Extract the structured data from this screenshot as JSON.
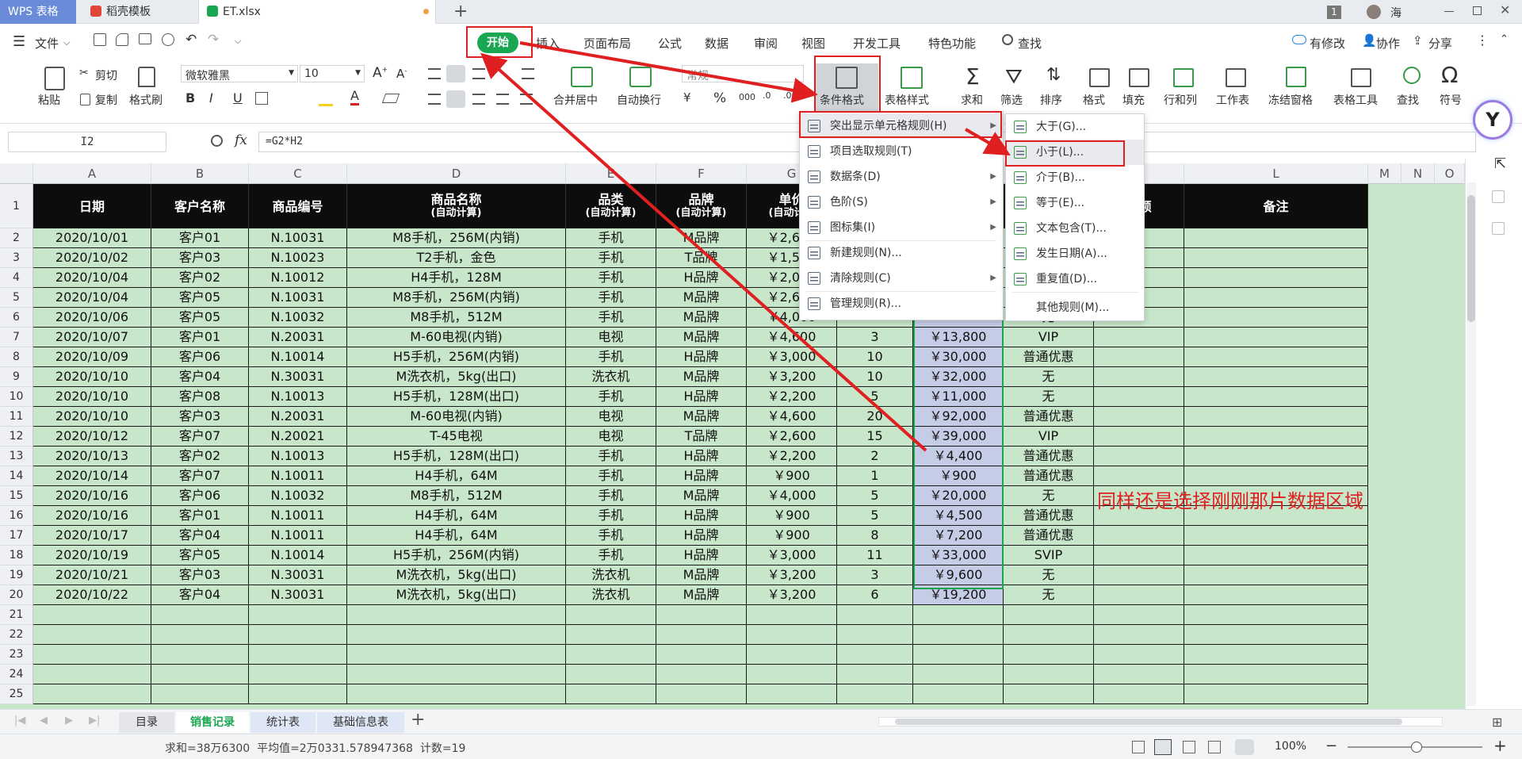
{
  "tabs": {
    "app": "WPS 表格",
    "templates": "稻壳模板",
    "file": "ET.xlsx",
    "add": "+",
    "badge": "1",
    "user": "海"
  },
  "menu": {
    "file": "文件",
    "items": [
      "开始",
      "插入",
      "页面布局",
      "公式",
      "数据",
      "审阅",
      "视图",
      "开发工具",
      "特色功能"
    ],
    "search": "查找",
    "modified": "有修改",
    "collab": "协作",
    "share": "分享"
  },
  "ribbon": {
    "paste": "粘贴",
    "cut": "剪切",
    "copy": "复制",
    "format_painter": "格式刷",
    "font_name": "微软雅黑",
    "font_size": "10",
    "bold": "B",
    "italic": "I",
    "underline": "U",
    "merge": "合并居中",
    "wrap": "自动换行",
    "number_format": "常规",
    "cond_format": "条件格式",
    "table_style": "表格样式",
    "sum": "求和",
    "filter": "筛选",
    "sort": "排序",
    "format": "格式",
    "fill": "填充",
    "rowcol": "行和列",
    "worksheet": "工作表",
    "freeze": "冻结窗格",
    "table_tools": "表格工具",
    "find": "查找",
    "symbol": "符号"
  },
  "formula": {
    "cell_ref": "I2",
    "fx": "fx",
    "formula": "=G2*H2"
  },
  "columns": [
    "A",
    "B",
    "C",
    "D",
    "E",
    "F",
    "G",
    "H",
    "I",
    "J",
    "K",
    "L",
    "M",
    "N",
    "O"
  ],
  "headers": [
    {
      "main": "日期",
      "sub": ""
    },
    {
      "main": "客户名称",
      "sub": ""
    },
    {
      "main": "商品编号",
      "sub": ""
    },
    {
      "main": "商品名称",
      "sub": "(自动计算)"
    },
    {
      "main": "品类",
      "sub": "(自动计算)"
    },
    {
      "main": "品牌",
      "sub": "(自动计算)"
    },
    {
      "main": "单价",
      "sub": "(自动计算"
    },
    {
      "main": "",
      "sub": ""
    },
    {
      "main": "",
      "sub": ""
    },
    {
      "main": "",
      "sub": ""
    },
    {
      "main": "金额",
      "sub": ""
    },
    {
      "main": "备注",
      "sub": ""
    }
  ],
  "rows": [
    [
      "2020/10/01",
      "客户01",
      "N.10031",
      "M8手机，256M(内销)",
      "手机",
      "M品牌",
      "￥2,600",
      "",
      "",
      "",
      ""
    ],
    [
      "2020/10/02",
      "客户03",
      "N.10023",
      "T2手机，金色",
      "手机",
      "T品牌",
      "￥1,500",
      "",
      "",
      "",
      ""
    ],
    [
      "2020/10/04",
      "客户02",
      "N.10012",
      "H4手机，128M",
      "手机",
      "H品牌",
      "￥2,000",
      "",
      "",
      "",
      ""
    ],
    [
      "2020/10/04",
      "客户05",
      "N.10031",
      "M8手机，256M(内销)",
      "手机",
      "M品牌",
      "￥2,600",
      "",
      "",
      "",
      ""
    ],
    [
      "2020/10/06",
      "客户05",
      "N.10032",
      "M8手机，512M",
      "手机",
      "M品牌",
      "￥4,000",
      "",
      "",
      "无",
      ""
    ],
    [
      "2020/10/07",
      "客户01",
      "N.20031",
      "M-60电视(内销)",
      "电视",
      "M品牌",
      "￥4,600",
      "3",
      "￥13,800",
      "VIP",
      ""
    ],
    [
      "2020/10/09",
      "客户06",
      "N.10014",
      "H5手机，256M(内销)",
      "手机",
      "H品牌",
      "￥3,000",
      "10",
      "￥30,000",
      "普通优惠",
      ""
    ],
    [
      "2020/10/10",
      "客户04",
      "N.30031",
      "M洗衣机，5kg(出口)",
      "洗衣机",
      "M品牌",
      "￥3,200",
      "10",
      "￥32,000",
      "无",
      ""
    ],
    [
      "2020/10/10",
      "客户08",
      "N.10013",
      "H5手机，128M(出口)",
      "手机",
      "H品牌",
      "￥2,200",
      "5",
      "￥11,000",
      "无",
      ""
    ],
    [
      "2020/10/10",
      "客户03",
      "N.20031",
      "M-60电视(内销)",
      "电视",
      "M品牌",
      "￥4,600",
      "20",
      "￥92,000",
      "普通优惠",
      ""
    ],
    [
      "2020/10/12",
      "客户07",
      "N.20021",
      "T-45电视",
      "电视",
      "T品牌",
      "￥2,600",
      "15",
      "￥39,000",
      "VIP",
      ""
    ],
    [
      "2020/10/13",
      "客户02",
      "N.10013",
      "H5手机，128M(出口)",
      "手机",
      "H品牌",
      "￥2,200",
      "2",
      "￥4,400",
      "普通优惠",
      ""
    ],
    [
      "2020/10/14",
      "客户07",
      "N.10011",
      "H4手机，64M",
      "手机",
      "H品牌",
      "￥900",
      "1",
      "￥900",
      "普通优惠",
      ""
    ],
    [
      "2020/10/16",
      "客户06",
      "N.10032",
      "M8手机，512M",
      "手机",
      "M品牌",
      "￥4,000",
      "5",
      "￥20,000",
      "无",
      ""
    ],
    [
      "2020/10/16",
      "客户01",
      "N.10011",
      "H4手机，64M",
      "手机",
      "H品牌",
      "￥900",
      "5",
      "￥4,500",
      "普通优惠",
      ""
    ],
    [
      "2020/10/17",
      "客户04",
      "N.10011",
      "H4手机，64M",
      "手机",
      "H品牌",
      "￥900",
      "8",
      "￥7,200",
      "普通优惠",
      ""
    ],
    [
      "2020/10/19",
      "客户05",
      "N.10014",
      "H5手机，256M(内销)",
      "手机",
      "H品牌",
      "￥3,000",
      "11",
      "￥33,000",
      "SVIP",
      ""
    ],
    [
      "2020/10/21",
      "客户03",
      "N.30031",
      "M洗衣机，5kg(出口)",
      "洗衣机",
      "M品牌",
      "￥3,200",
      "3",
      "￥9,600",
      "无",
      ""
    ],
    [
      "2020/10/22",
      "客户04",
      "N.30031",
      "M洗衣机，5kg(出口)",
      "洗衣机",
      "M品牌",
      "￥3,200",
      "6",
      "￥19,200",
      "无",
      ""
    ]
  ],
  "row_numbers": [
    "1",
    "2",
    "3",
    "4",
    "5",
    "6",
    "7",
    "8",
    "9",
    "10",
    "11",
    "12",
    "13",
    "14",
    "15",
    "16",
    "17",
    "18",
    "19",
    "20",
    "21",
    "22",
    "23",
    "24",
    "25"
  ],
  "dropdown": [
    {
      "label": "突出显示单元格规则(H)",
      "arrow": true
    },
    {
      "label": "项目选取规则(T)",
      "arrow": true
    },
    {
      "label": "数据条(D)",
      "arrow": true
    },
    {
      "label": "色阶(S)",
      "arrow": true
    },
    {
      "label": "图标集(I)",
      "arrow": true
    },
    {
      "label": "新建规则(N)...",
      "arrow": false
    },
    {
      "label": "清除规则(C)",
      "arrow": true
    },
    {
      "label": "管理规则(R)...",
      "arrow": false
    }
  ],
  "submenu": [
    "大于(G)...",
    "小于(L)...",
    "介于(B)...",
    "等于(E)...",
    "文本包含(T)...",
    "发生日期(A)...",
    "重复值(D)...",
    "其他规则(M)..."
  ],
  "annotation": "同样还是选择刚刚那片数据区域",
  "sheets": [
    "目录",
    "销售记录",
    "统计表",
    "基础信息表"
  ],
  "status": {
    "summary": "求和=38万6300  平均值=2万0331.578947368  计数=19",
    "zoom": "100%"
  },
  "colors": {
    "accent": "#1aa752",
    "cell_bg": "#c8e6c9",
    "annotation": "#e02020",
    "selection": "#c5cce6"
  }
}
